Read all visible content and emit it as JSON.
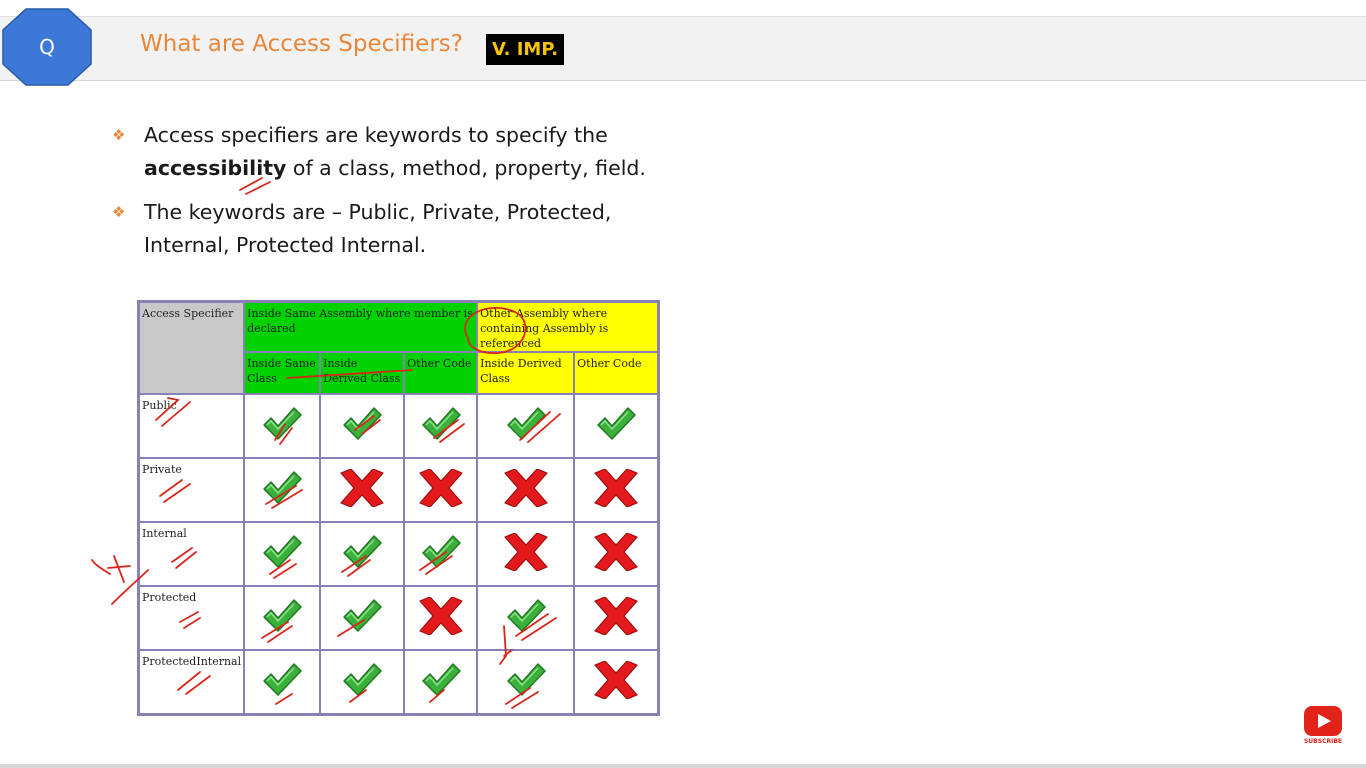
{
  "header": {
    "badge_letter": "Q",
    "title": "What are Access Specifiers?",
    "importance_badge": "V. IMP."
  },
  "bullets": [
    {
      "line1": "Access specifiers are keywords to specify the",
      "bold": "accessibility",
      "rest": " of a class, method, property, field."
    },
    {
      "line1": "The keywords are – Public, Private, Protected,",
      "line2": "Internal, Protected Internal."
    }
  ],
  "table": {
    "corner_header": "Access Specifier",
    "group_headers": [
      {
        "label": "Inside Same Assembly where member is declared",
        "color": "#00d200"
      },
      {
        "label": "Other Assembly where containing Assembly is referenced",
        "color": "#ffff00"
      }
    ],
    "sub_headers": [
      "Inside Same Class",
      "Inside Derived Class",
      "Other Code",
      "Inside Derived Class",
      "Other Code"
    ],
    "rows": [
      {
        "label": "Public",
        "marks": [
          "check",
          "check",
          "check",
          "check",
          "check"
        ]
      },
      {
        "label": "Private",
        "marks": [
          "check",
          "cross",
          "cross",
          "cross",
          "cross"
        ]
      },
      {
        "label": "Internal",
        "marks": [
          "check",
          "check",
          "check",
          "cross",
          "cross"
        ]
      },
      {
        "label": "Protected",
        "marks": [
          "check",
          "check",
          "cross",
          "check",
          "cross"
        ]
      },
      {
        "label": "ProtectedInternal",
        "marks": [
          "check",
          "check",
          "check",
          "check",
          "cross"
        ]
      }
    ]
  },
  "subscribe_label": "SUBSCRIBE",
  "colors": {
    "accent_orange": "#e8873a",
    "badge_blue": "#3c78d8",
    "check_green": "#3bb13b",
    "cross_red": "#e4191c",
    "annotation_red": "#d9261c"
  }
}
